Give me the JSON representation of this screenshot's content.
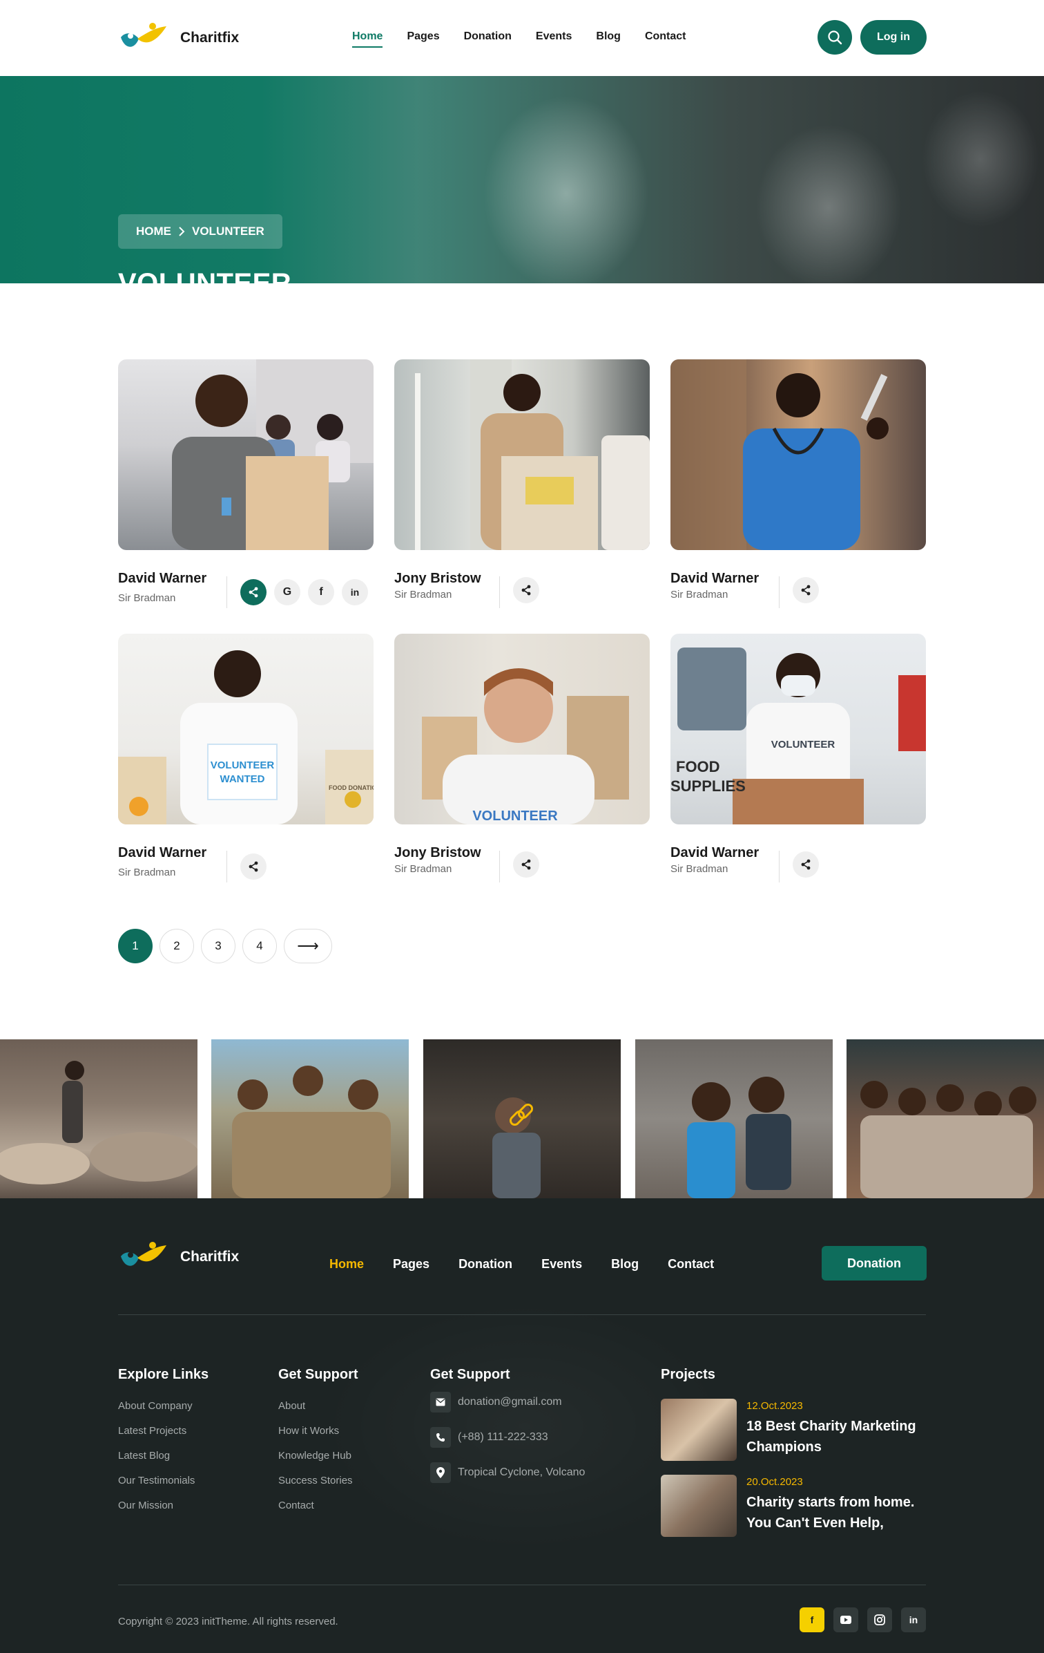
{
  "header": {
    "brand": "Charitfix",
    "nav": [
      "Home",
      "Pages",
      "Donation",
      "Events",
      "Blog",
      "Contact"
    ],
    "active_nav": "Home",
    "login_label": "Log in"
  },
  "hero": {
    "breadcrumb_home": "HOME",
    "breadcrumb_current": "VOLUNTEER",
    "title": "VOLUNTEER"
  },
  "volunteers": [
    {
      "name": "David Warner",
      "role": "Sir Bradman"
    },
    {
      "name": "Jony Bristow",
      "role": "Sir Bradman"
    },
    {
      "name": "David Warner",
      "role": "Sir Bradman"
    },
    {
      "name": "David Warner",
      "role": "Sir Bradman"
    },
    {
      "name": "Jony Bristow",
      "role": "Sir Bradman"
    },
    {
      "name": "David Warner",
      "role": "Sir Bradman"
    }
  ],
  "card_photo_text": {
    "sign_line1": "VOLUNTEER",
    "sign_line2": "WANTED",
    "box_label": "FOOD DONATION",
    "shirt": "VOLUNTEER",
    "food_line1": "FOOD",
    "food_line2": "SUPPLIES"
  },
  "social_labels": {
    "google": "G",
    "facebook": "f",
    "linkedin": "in"
  },
  "pagination": {
    "pages": [
      "1",
      "2",
      "3",
      "4"
    ],
    "current": "1",
    "next_arrow": "⟶"
  },
  "footer": {
    "brand": "Charitfix",
    "nav": [
      "Home",
      "Pages",
      "Donation",
      "Events",
      "Blog",
      "Contact"
    ],
    "active_nav": "Home",
    "donation_label": "Donation",
    "explore_title": "Explore Links",
    "explore_links": [
      "About Company",
      "Latest Projects",
      "Latest Blog",
      "Our Testimonials",
      "Our Mission"
    ],
    "support_title": "Get Support",
    "support_links": [
      "About",
      "How it Works",
      "Knowledge Hub",
      "Success Stories",
      "Contact"
    ],
    "contact_title": "Get Support",
    "email": "donation@gmail.com",
    "phone": "(+88) 111-222-333",
    "address": "Tropical Cyclone, Volcano",
    "projects_title": "Projects",
    "projects": [
      {
        "date": "12.Oct.2023",
        "title": "18 Best Charity Marketing Champions"
      },
      {
        "date": "20.Oct.2023",
        "title": "Charity starts from home. You Can't Even Help,"
      }
    ],
    "copyright": "Copyright © 2023 initTheme. All rights reserved.",
    "social_labels": {
      "facebook": "f",
      "linkedin": "in"
    }
  },
  "colors": {
    "primary": "#0e6d5c",
    "accent": "#f5b800",
    "footer_bg": "#1d2424"
  }
}
